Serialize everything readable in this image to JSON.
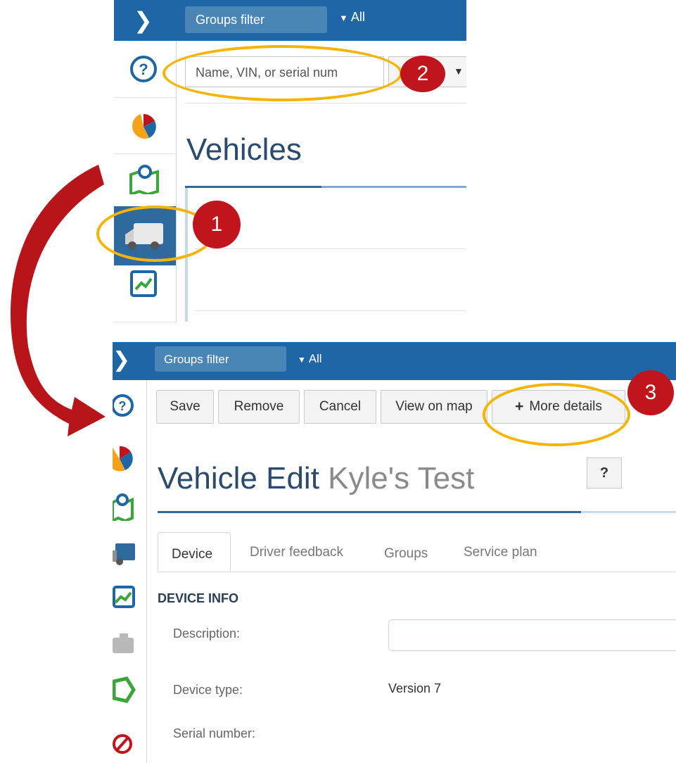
{
  "top_panel": {
    "groups_filter_label": "Groups filter",
    "groups_filter_value": "All",
    "search": {
      "placeholder": "Name, VIN, or serial num"
    },
    "page_title": "Vehicles",
    "callout_1": "1",
    "callout_2": "2"
  },
  "bottom_panel": {
    "groups_filter_label": "Groups filter",
    "groups_filter_value": "All",
    "toolbar": {
      "save": "Save",
      "remove": "Remove",
      "cancel": "Cancel",
      "view_on_map": "View on map",
      "more_details": "More details"
    },
    "callout_3": "3",
    "title_prefix": "Vehicle Edit",
    "title_name": "Kyle's Test",
    "help": "?",
    "tabs": [
      "Device",
      "Driver feedback",
      "Groups",
      "Service plan"
    ],
    "section_heading": "DEVICE INFO",
    "fields": {
      "description_label": "Description:",
      "device_type_label": "Device type:",
      "device_type_value": "Version 7",
      "serial_label": "Serial number:"
    }
  },
  "colors": {
    "accent_blue": "#1f66a6",
    "callout_red": "#c0151c",
    "highlight": "#f4b400"
  }
}
